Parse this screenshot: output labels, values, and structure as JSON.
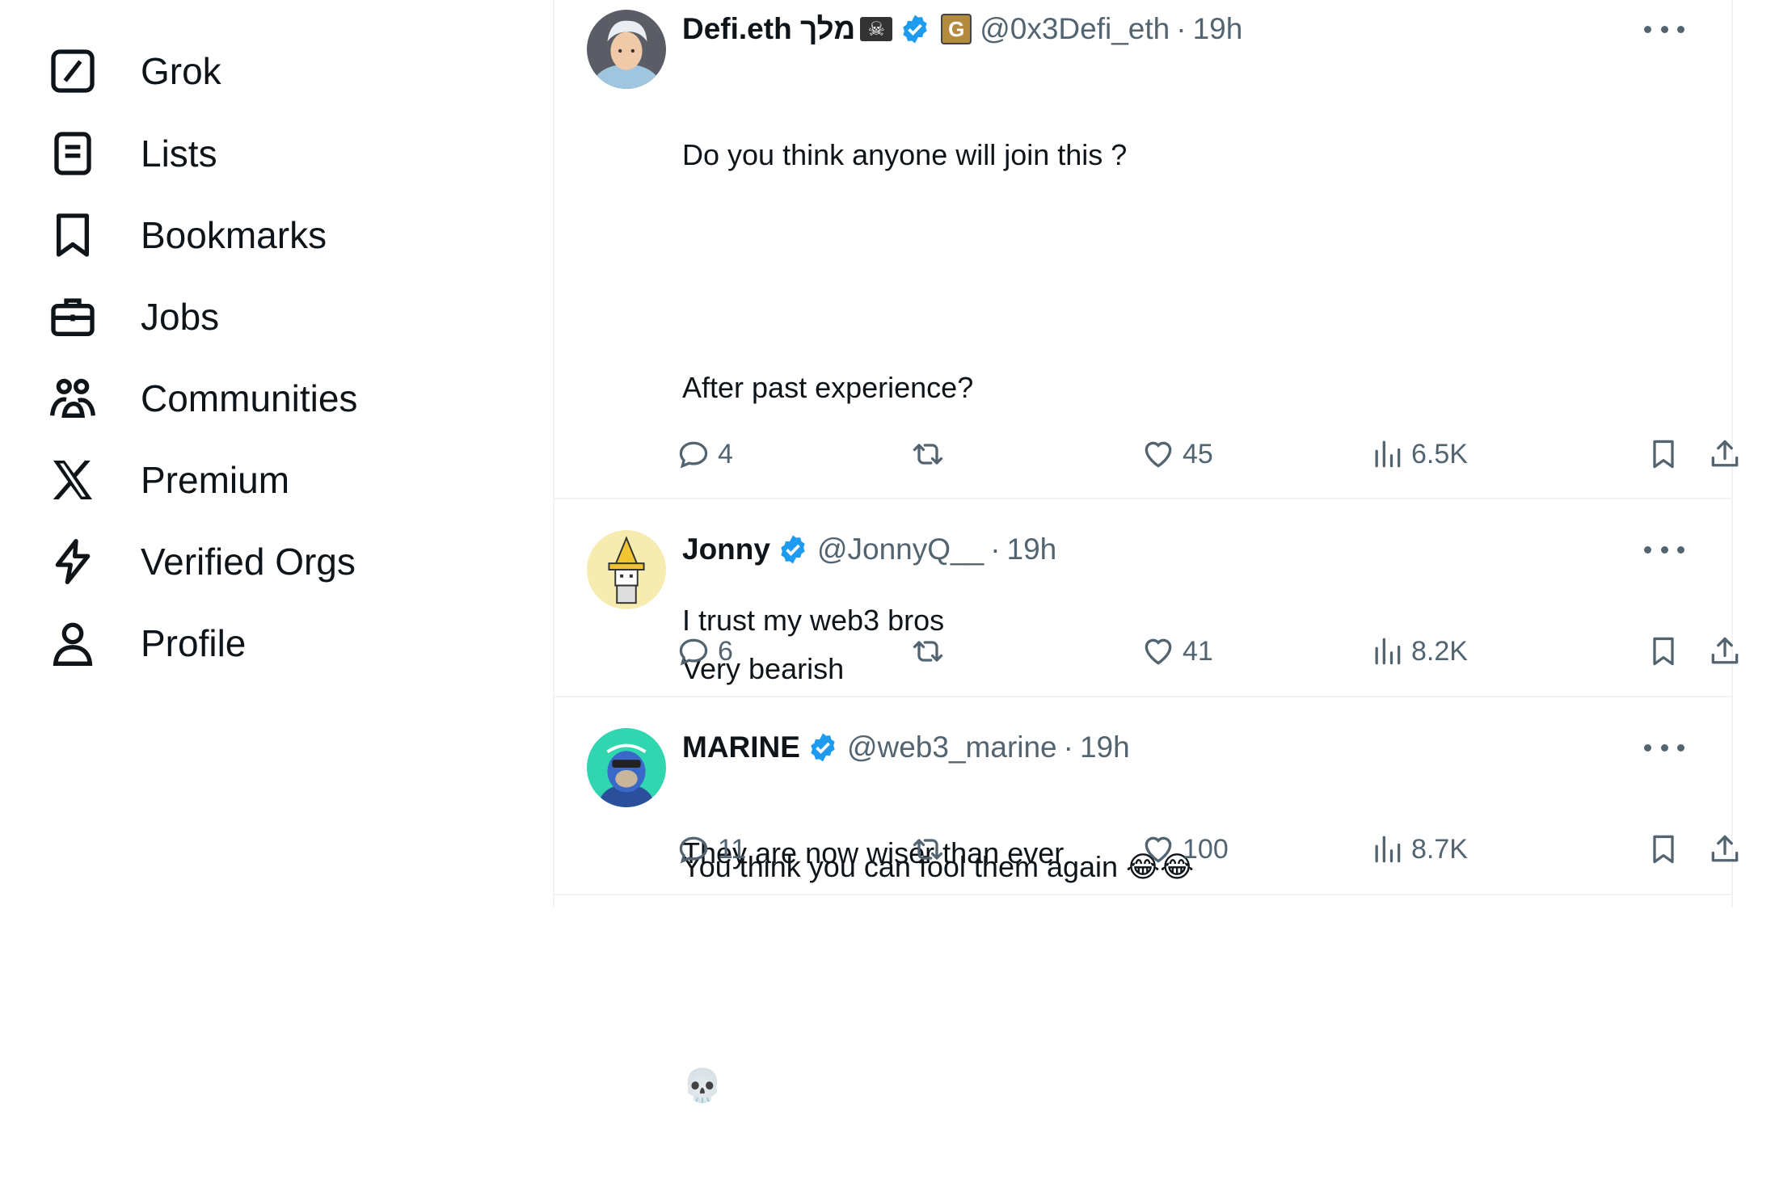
{
  "sidebar": {
    "items": [
      {
        "label": "Grok",
        "icon": "grok-icon"
      },
      {
        "label": "Lists",
        "icon": "lists-icon"
      },
      {
        "label": "Bookmarks",
        "icon": "bookmark-icon"
      },
      {
        "label": "Jobs",
        "icon": "briefcase-icon"
      },
      {
        "label": "Communities",
        "icon": "communities-icon"
      },
      {
        "label": "Premium",
        "icon": "x-logo-icon"
      },
      {
        "label": "Verified Orgs",
        "icon": "lightning-icon"
      },
      {
        "label": "Profile",
        "icon": "person-icon"
      }
    ]
  },
  "tweets": [
    {
      "name": "Defi.eth מלך",
      "flag": "☠",
      "affiliate": "G",
      "handle": "@0x3Defi_eth",
      "dot": "·",
      "time": "19h",
      "lines": [
        "Do you think anyone will join this ?",
        "",
        "After past experience?",
        "",
        "I trust my web3 bros",
        "",
        "They are now wiser than ever",
        "",
        "💀"
      ],
      "replies": "4",
      "likes": "45",
      "views": "6.5K"
    },
    {
      "name": "Jonny",
      "handle": "@JonnyQ__",
      "dot": "·",
      "time": "19h",
      "lines": [
        "Very bearish"
      ],
      "replies": "6",
      "likes": "41",
      "views": "8.2K"
    },
    {
      "name": "MARINE",
      "handle": "@web3_marine",
      "dot": "·",
      "time": "19h",
      "lines": [
        "You think you can fool them again 😂😂"
      ],
      "replies": "11",
      "likes": "100",
      "views": "8.7K"
    }
  ],
  "colors": {
    "text": "#0f1419",
    "secondary": "#536471",
    "verified": "#1d9bf0",
    "border": "#eff3f4"
  }
}
